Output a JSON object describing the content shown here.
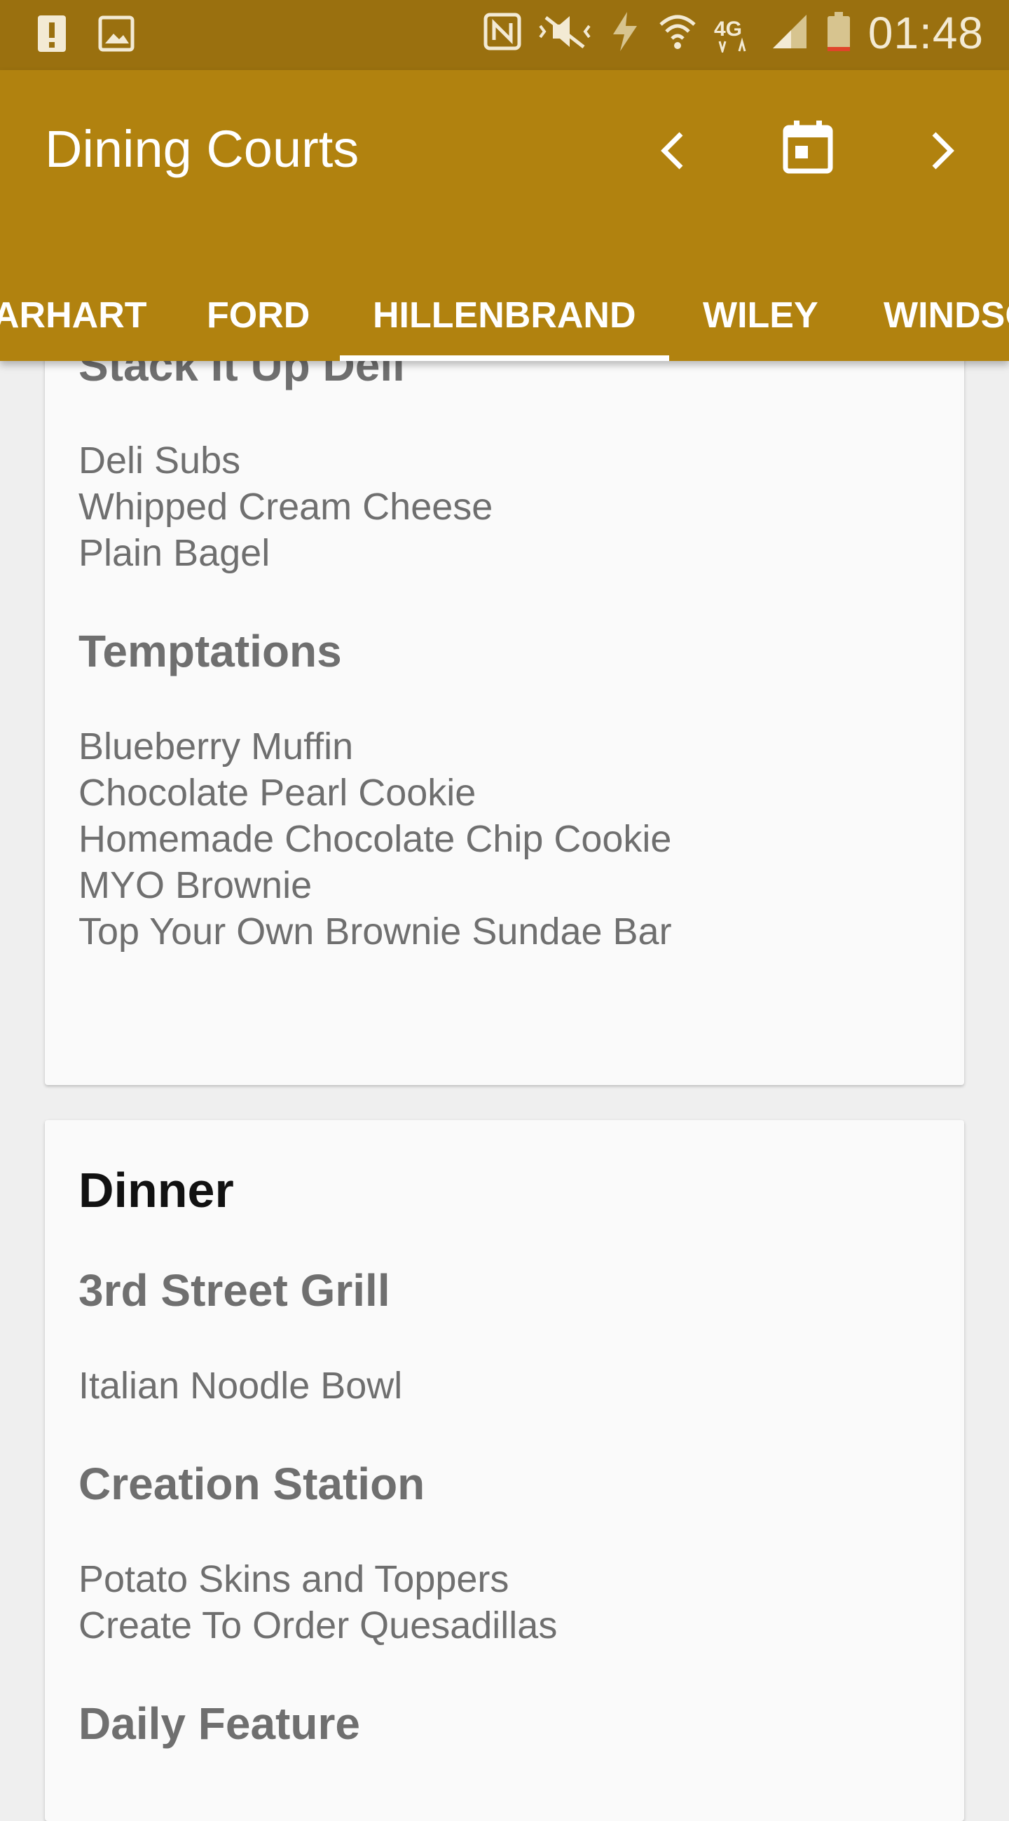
{
  "status_bar": {
    "time": "01:48",
    "icons": [
      "alert-icon",
      "image-icon",
      "nfc-icon",
      "mute-icon",
      "data-icon",
      "wifi-icon",
      "lte-icon",
      "signal-icon",
      "battery-icon"
    ]
  },
  "app_bar": {
    "title": "Dining Courts",
    "icons": [
      "chevron-left-icon",
      "calendar-icon",
      "chevron-right-icon"
    ],
    "tabs": [
      "ARHART",
      "FORD",
      "HILLENBRAND",
      "WILEY",
      "WINDSO"
    ],
    "selected_tab": "HILLENBRAND",
    "colors": {
      "primary": "#b1820f",
      "status": "#9a700f"
    }
  },
  "card1": {
    "stations": [
      {
        "name": "Stack It Up Deli",
        "items": [
          "Deli Subs",
          "Whipped Cream Cheese",
          "Plain Bagel"
        ]
      },
      {
        "name": "Temptations",
        "items": [
          "Blueberry Muffin",
          "Chocolate Pearl Cookie",
          "Homemade Chocolate Chip Cookie",
          "MYO Brownie",
          "Top Your Own Brownie Sundae Bar"
        ]
      }
    ]
  },
  "card2": {
    "meal": "Dinner",
    "stations": [
      {
        "name": "3rd Street Grill",
        "items": [
          "Italian Noodle Bowl"
        ]
      },
      {
        "name": "Creation Station",
        "items": [
          "Potato Skins and Toppers",
          "Create To Order Quesadillas"
        ]
      },
      {
        "name": "Daily Feature",
        "items": []
      }
    ]
  }
}
